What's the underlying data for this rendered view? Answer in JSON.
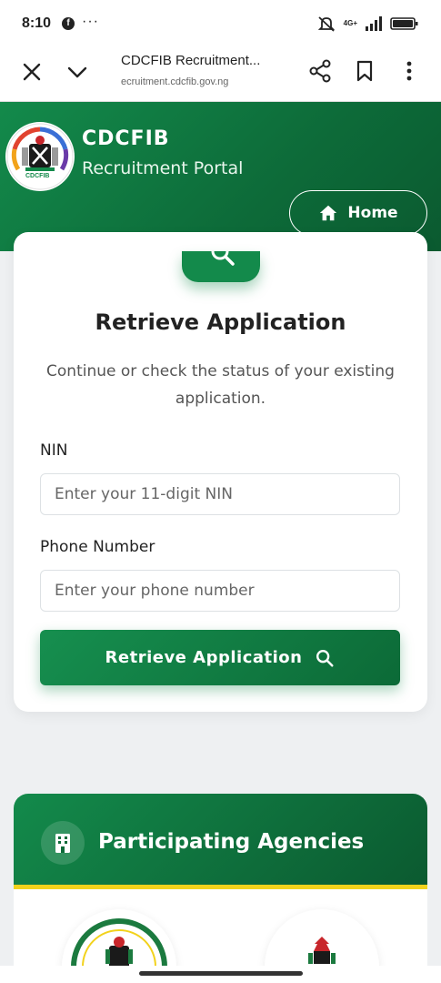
{
  "status_bar": {
    "time": "8:10",
    "network": "4G+",
    "fb_glyph": "f",
    "more_glyph": "···"
  },
  "browser": {
    "title": "CDCFIB Recruitment...",
    "url": "ecruitment.cdcfib.gov.ng",
    "icons": [
      "close-icon",
      "chevron-down-icon",
      "share-icon",
      "bookmark-icon",
      "kebab-menu-icon"
    ]
  },
  "header": {
    "brand": "CDCFIB",
    "subtitle": "Recruitment Portal",
    "logo_text": "CDCFIB",
    "home_button": "Home"
  },
  "retrieve": {
    "title": "Retrieve Application",
    "description": "Continue or check the status of your existing application.",
    "nin_label": "NIN",
    "nin_placeholder": "Enter your 11-digit NIN",
    "phone_label": "Phone Number",
    "phone_placeholder": "Enter your phone number",
    "submit_label": "Retrieve Application"
  },
  "agencies": {
    "title": "Participating Agencies"
  },
  "colors": {
    "brand_green": "#138a4b",
    "brand_green_dark": "#0b5a30",
    "accent_yellow": "#f2d21c",
    "page_bg": "#eef0f2"
  }
}
